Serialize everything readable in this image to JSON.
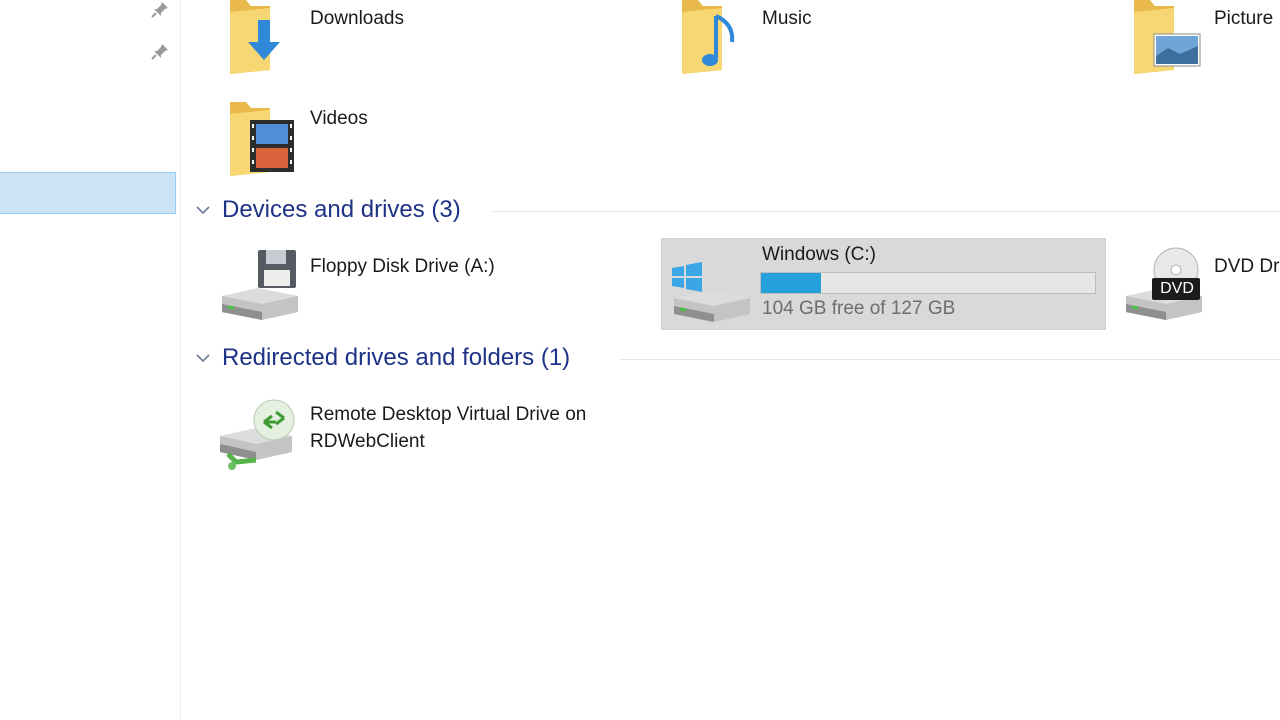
{
  "quick_access": {
    "items": [
      {
        "label": "Downloads",
        "icon": "downloads-folder-icon"
      },
      {
        "label": "Music",
        "icon": "music-folder-icon"
      },
      {
        "label": "Picture",
        "icon": "pictures-folder-icon"
      },
      {
        "label": "Videos",
        "icon": "videos-folder-icon"
      }
    ]
  },
  "groups": {
    "devices": {
      "title": "Devices and drives (3)"
    },
    "redirected": {
      "title": "Redirected drives and folders (1)"
    }
  },
  "drives": {
    "floppy": {
      "label": "Floppy Disk Drive (A:)",
      "icon": "floppy-drive-icon"
    },
    "windows": {
      "label": "Windows (C:)",
      "free": "104 GB free of 127 GB",
      "used_fraction": 0.18,
      "icon": "windows-drive-icon"
    },
    "dvd": {
      "label": "DVD Dr",
      "badge": "DVD",
      "icon": "dvd-drive-icon"
    },
    "remote": {
      "label_line1": "Remote Desktop Virtual Drive on",
      "label_line2": "RDWebClient",
      "icon": "network-drive-icon"
    }
  },
  "colors": {
    "accent": "#26a0da",
    "group_title": "#1e3287",
    "selection": "#cce4f7",
    "drive_selection": "#d9d9d9"
  }
}
